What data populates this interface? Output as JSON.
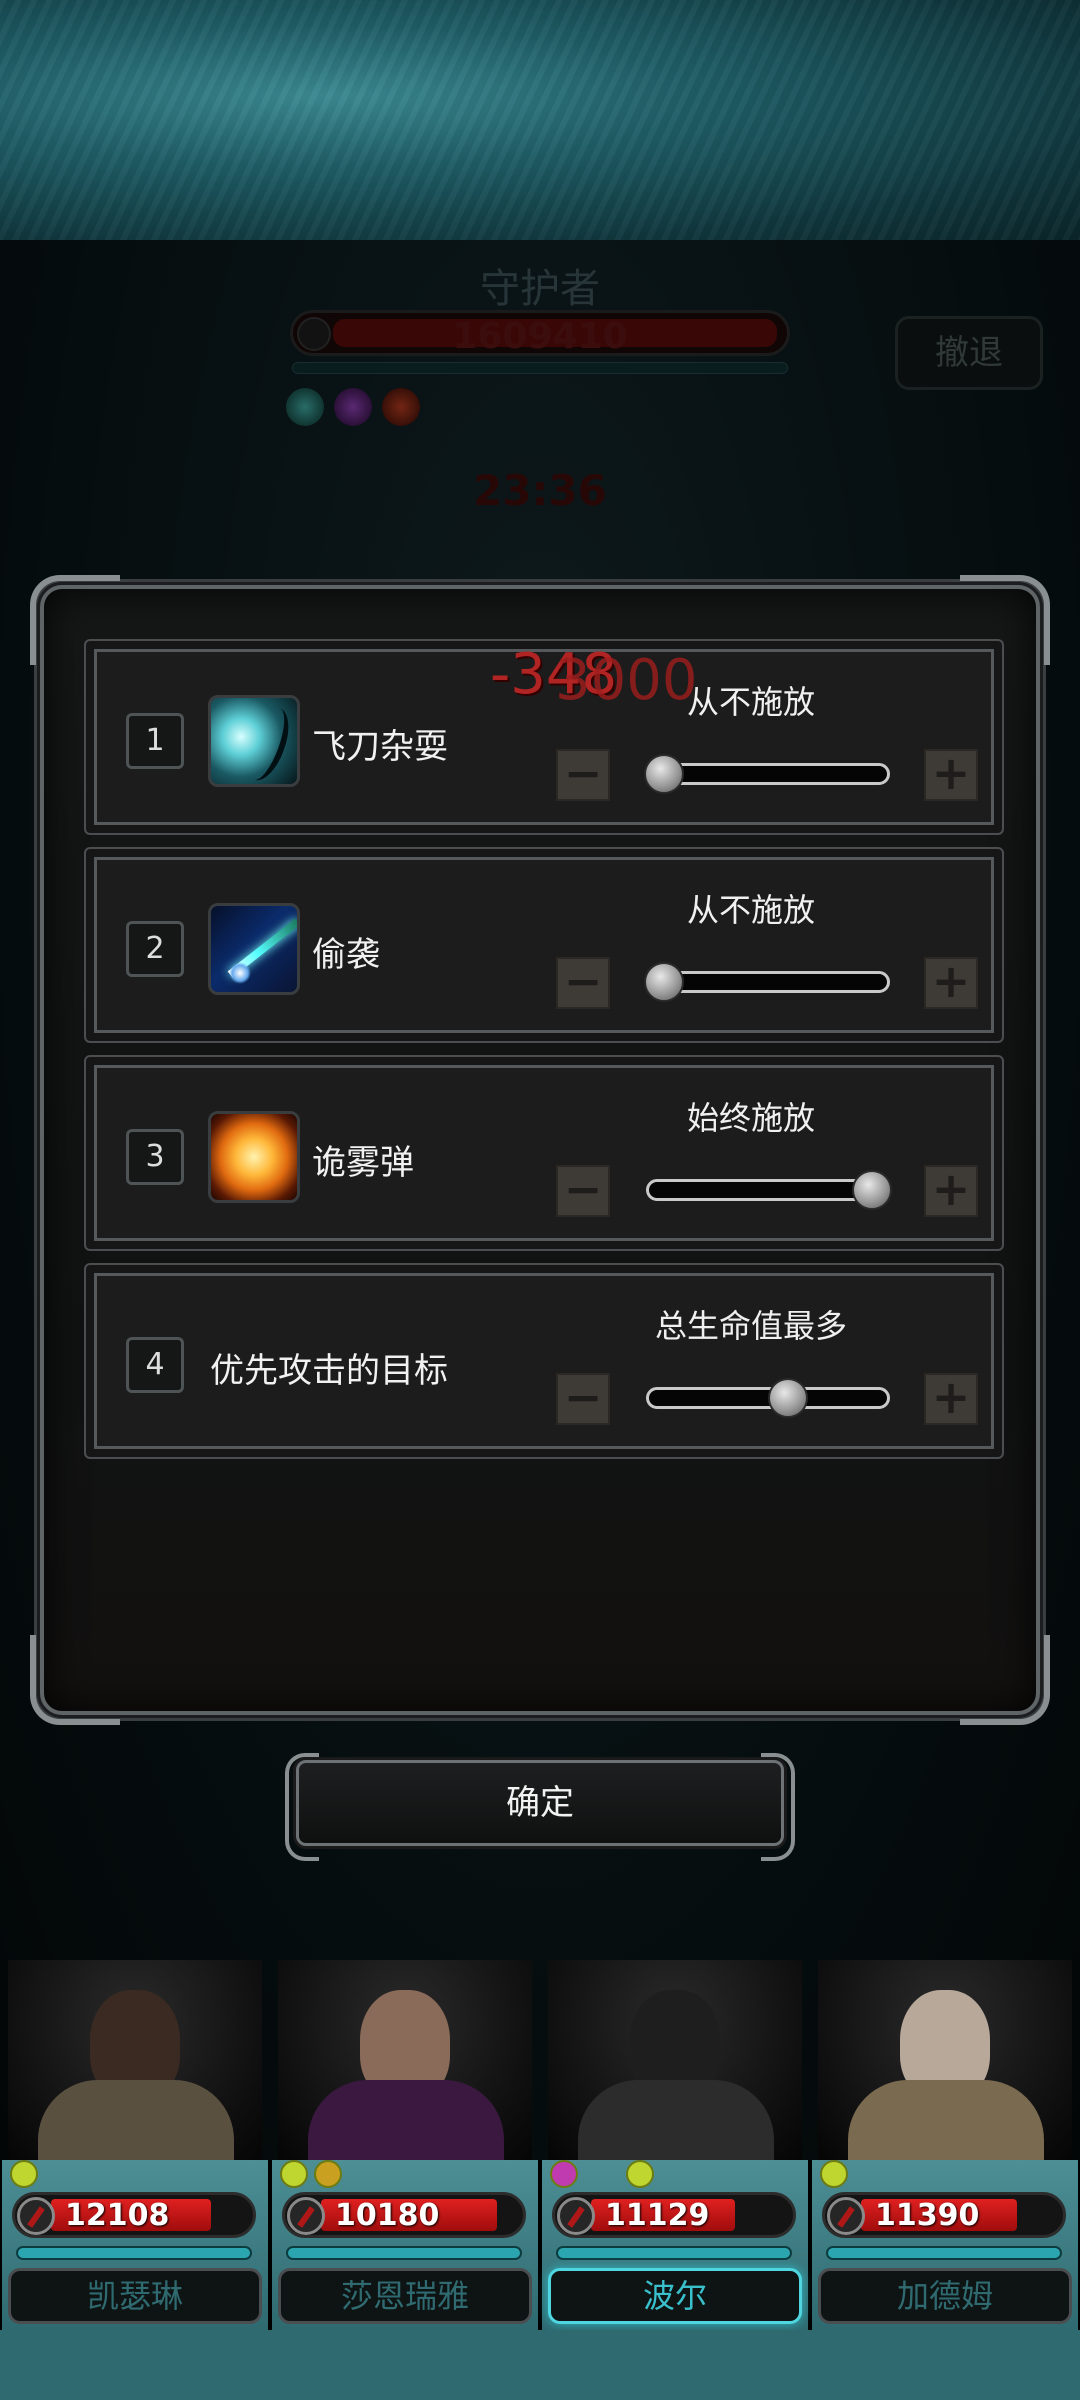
{
  "boss": {
    "name": "守护者",
    "hp": "1609410",
    "timer": "23:36",
    "retreat_label": "撤退",
    "floating_damage": "-348",
    "floating_damage_2": "3000"
  },
  "dialog": {
    "rows": [
      {
        "index": "1",
        "icon": "throwing-knives-icon",
        "name": "飞刀杂耍",
        "mode": "从不施放",
        "level": 0
      },
      {
        "index": "2",
        "icon": "sneak-attack-icon",
        "name": "偷袭",
        "mode": "从不施放",
        "level": 0
      },
      {
        "index": "3",
        "icon": "smoke-bomb-icon",
        "name": "诡雾弹",
        "mode": "始终施放",
        "level": 1
      },
      {
        "index": "4",
        "name": "优先攻击的目标",
        "mode": "总生命值最多",
        "level": 0.6
      }
    ],
    "minus_label": "−",
    "plus_label": "+",
    "confirm_label": "确定"
  },
  "party": [
    {
      "name": "凯瑟琳",
      "hp": "12108",
      "hp_fraction": 0.8,
      "active": false
    },
    {
      "name": "莎恩瑞雅",
      "hp": "10180",
      "hp_fraction": 0.88,
      "active": false
    },
    {
      "name": "波尔",
      "hp": "11129",
      "hp_fraction": 0.72,
      "active": true
    },
    {
      "name": "加德姆",
      "hp": "11390",
      "hp_fraction": 0.78,
      "active": false
    }
  ],
  "colors": {
    "accent_cyan": "#39c0cc",
    "hp_red": "#e02020",
    "panel_border": "#5f6466"
  }
}
